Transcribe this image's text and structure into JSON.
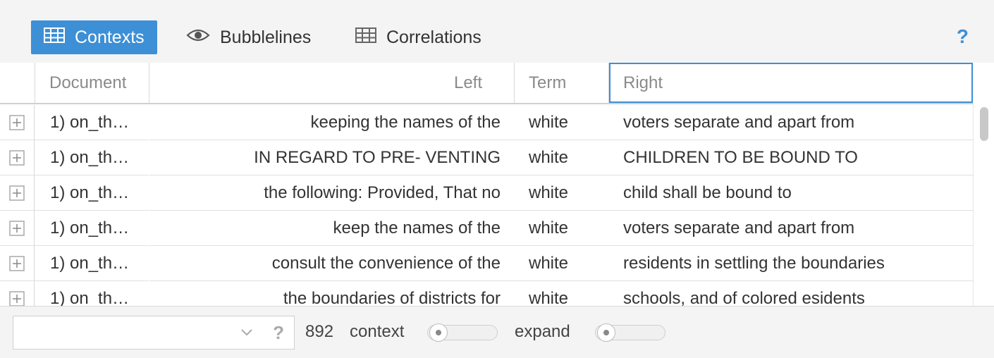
{
  "tabs": [
    {
      "label": "Contexts",
      "icon": "table-icon",
      "active": true
    },
    {
      "label": "Bubblelines",
      "icon": "eye-icon",
      "active": false
    },
    {
      "label": "Correlations",
      "icon": "table-icon",
      "active": false
    }
  ],
  "help_label": "?",
  "columns": {
    "document": "Document",
    "left": "Left",
    "term": "Term",
    "right": "Right"
  },
  "rows": [
    {
      "document": "1) on_th…",
      "left": "keeping the names of the",
      "term": "white",
      "right": "voters separate and apart from"
    },
    {
      "document": "1) on_th…",
      "left": "IN REGARD TO PRE- VENTING",
      "term": "white",
      "right": "CHILDREN TO BE BOUND TO"
    },
    {
      "document": "1) on_th…",
      "left": "the following: Provided, That no",
      "term": "white",
      "right": "child shall be bound to"
    },
    {
      "document": "1) on_th…",
      "left": "keep the names of the",
      "term": "white",
      "right": "voters separate and apart from"
    },
    {
      "document": "1) on_th…",
      "left": "consult the convenience of the",
      "term": "white",
      "right": "residents in settling the boundaries"
    },
    {
      "document": "1) on_th…",
      "left": "the boundaries of districts for",
      "term": "white",
      "right": "schools, and of colored esidents"
    }
  ],
  "footer": {
    "combo_value": "",
    "combo_help": "?",
    "count": "892",
    "context_label": "context",
    "context_value": 0,
    "expand_label": "expand",
    "expand_value": 0
  },
  "colors": {
    "accent": "#3d8fd6"
  }
}
